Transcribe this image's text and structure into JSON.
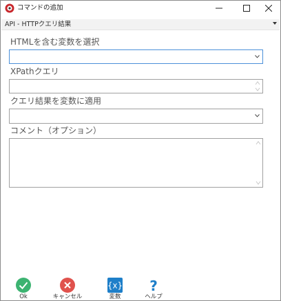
{
  "window": {
    "title": "コマンドの追加"
  },
  "category": {
    "selected": "API - HTTPクエリ結果"
  },
  "form": {
    "html_var_label": "HTMLを含む変数を選択",
    "html_var_value": "",
    "xpath_label": "XPathクエリ",
    "xpath_value": "",
    "apply_label": "クエリ結果を変数に適用",
    "apply_value": "",
    "comment_label": "コメント（オプション）",
    "comment_value": ""
  },
  "buttons": {
    "ok": "Ok",
    "cancel": "キャンセル",
    "variables": "変数",
    "help": "ヘルプ"
  },
  "colors": {
    "ok": "#3cb371",
    "cancel": "#e0524d",
    "variables": "#1e7fc9",
    "help": "#1e7fc9",
    "focus_border": "#4a8fd9"
  },
  "icons": {
    "app": "app-logo-icon",
    "ok": "check-icon",
    "cancel": "close-icon",
    "variables": "braces-x-icon",
    "help": "question-icon"
  }
}
